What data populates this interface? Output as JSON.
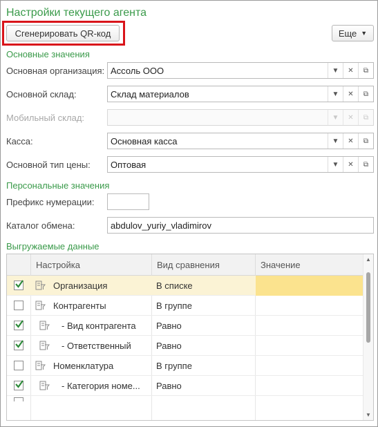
{
  "window": {
    "title": "Настройки текущего агента"
  },
  "toolbar": {
    "qr_button": "Сгенерировать QR-код",
    "more_button": "Еще"
  },
  "sections": {
    "main": "Основные значения",
    "personal": "Персональные значения",
    "export": "Выгружаемые данные"
  },
  "main_fields": [
    {
      "label": "Основная организация:",
      "value": "Ассоль ООО",
      "disabled": false
    },
    {
      "label": "Основной склад:",
      "value": "Склад материалов",
      "disabled": false
    },
    {
      "label": "Мобильный склад:",
      "value": "",
      "disabled": true
    },
    {
      "label": "Касса:",
      "value": "Основная касса",
      "disabled": false
    },
    {
      "label": "Основной тип цены:",
      "value": "Оптовая",
      "disabled": false
    }
  ],
  "personal_fields": {
    "prefix_label": "Префикс нумерации:",
    "prefix_value": "",
    "catalog_label": "Каталог обмена:",
    "catalog_value": "abdulov_yuriy_vladimirov"
  },
  "table": {
    "columns": [
      "Настройка",
      "Вид сравнения",
      "Значение"
    ],
    "rows": [
      {
        "checked": true,
        "name": "Организация",
        "comparison": "В списке",
        "value": ""
      },
      {
        "checked": false,
        "name": "Контрагенты",
        "comparison": "В группе",
        "value": ""
      },
      {
        "checked": true,
        "name": "- Вид контрагента",
        "comparison": "Равно",
        "value": ""
      },
      {
        "checked": true,
        "name": "- Ответственный",
        "comparison": "Равно",
        "value": ""
      },
      {
        "checked": false,
        "name": "Номенклатура",
        "comparison": "В группе",
        "value": ""
      },
      {
        "checked": true,
        "name": "- Категория номе...",
        "comparison": "Равно",
        "value": ""
      }
    ]
  },
  "colors": {
    "accent_green": "#3a9a4a",
    "selected_row": "#fbf3d5",
    "selected_value_cell": "#fbe38e",
    "highlight_red": "#d9141a",
    "checkmark": "#2e8b3a"
  }
}
